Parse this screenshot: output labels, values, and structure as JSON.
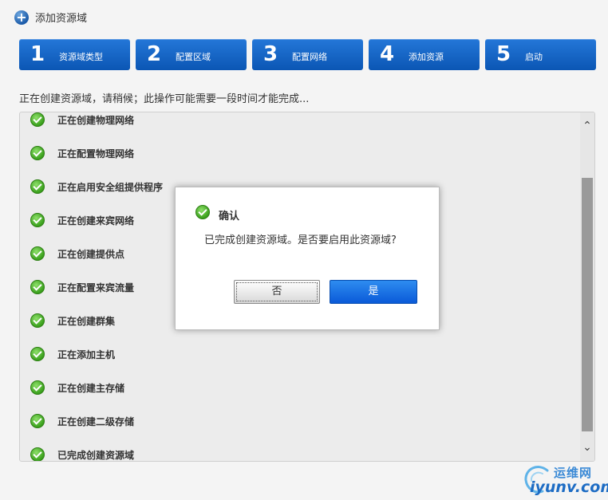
{
  "header": {
    "title": "添加资源域"
  },
  "steps": [
    {
      "num": "1",
      "label": "资源域类型"
    },
    {
      "num": "2",
      "label": "配置区域"
    },
    {
      "num": "3",
      "label": "配置网络"
    },
    {
      "num": "4",
      "label": "添加资源"
    },
    {
      "num": "5",
      "label": "启动"
    }
  ],
  "status_text": "正在创建资源域，请稍候；此操作可能需要一段时间才能完成...",
  "progress_items": [
    "正在创建物理网络",
    "正在配置物理网络",
    "正在启用安全组提供程序",
    "正在创建来宾网络",
    "正在创建提供点",
    "正在配置来宾流量",
    "正在创建群集",
    "正在添加主机",
    "正在创建主存储",
    "正在创建二级存储",
    "已完成创建资源域"
  ],
  "dialog": {
    "title": "确认",
    "message": "已完成创建资源域。是否要启用此资源域?",
    "no_label": "否",
    "yes_label": "是"
  },
  "watermark": {
    "cn": "运维网",
    "en": "iyunv.com"
  },
  "colors": {
    "step_blue": "#0b56b4",
    "check_green": "#3aa01c",
    "yes_button": "#0a5ad8"
  }
}
